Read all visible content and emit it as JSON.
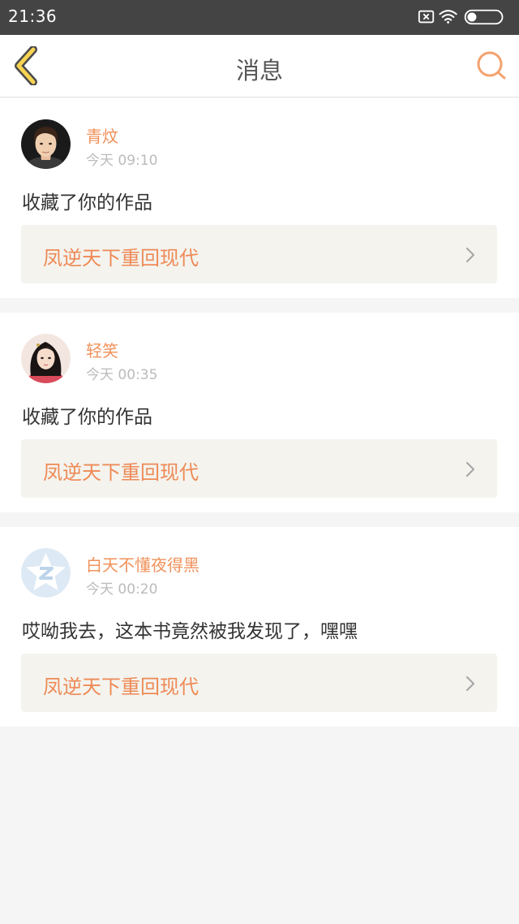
{
  "status_bar": {
    "time": "21:36",
    "icons": [
      "sim-x-icon",
      "wifi-icon",
      "battery-icon"
    ]
  },
  "nav": {
    "title": "消息",
    "back_icon": "chevron-left-icon",
    "search_icon": "search-icon"
  },
  "messages": [
    {
      "user": "青炆",
      "time": "今天 09:10",
      "text": "收藏了你的作品",
      "book": "凤逆天下重回现代",
      "avatar": "male-avatar"
    },
    {
      "user": "轻笑",
      "time": "今天 00:35",
      "text": "收藏了你的作品",
      "book": "凤逆天下重回现代",
      "avatar": "female-avatar"
    },
    {
      "user": "白天不懂夜得黑",
      "time": "今天 00:20",
      "text": "哎呦我去，这本书竟然被我发现了，嘿嘿",
      "book": "凤逆天下重回现代",
      "avatar": "default-avatar"
    }
  ],
  "colors": {
    "accent": "#f0915a",
    "status_bar": "#444444",
    "book_bg": "#f4f3ee",
    "page_bg": "#f5f5f5"
  }
}
